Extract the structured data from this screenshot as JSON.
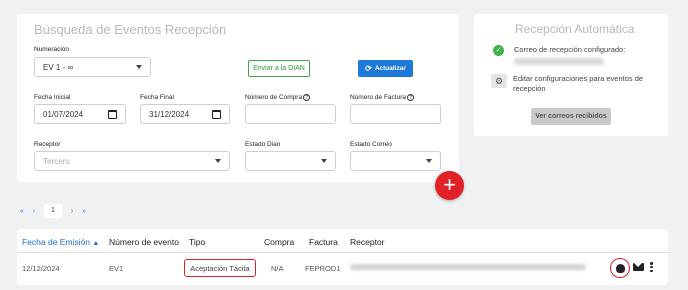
{
  "search": {
    "title": "Búsqueda de Eventos Recepción",
    "numeracion_label": "Numeración",
    "numeracion_value": "EV 1 - ∞",
    "enviar_dian_label": "Enviar a la DIAN",
    "actualizar_label": "Actualizar",
    "fecha_inicial_label": "Fecha Inicial",
    "fecha_inicial_value": "01/07/2024",
    "fecha_final_label": "Fecha Final",
    "fecha_final_value": "31/12/2024",
    "numero_compra_label": "Número de Compra",
    "numero_factura_label": "Número de Factura",
    "receptor_label": "Receptor",
    "receptor_placeholder": "Tercero",
    "estado_dian_label": "Estado Dian",
    "estado_correo_label": "Estado Correo"
  },
  "auto": {
    "title": "Recepción Automática",
    "correo_configurado": "Correo de recepción configurado:",
    "editar_config": "Editar configuraciones para eventos de recepción",
    "ver_correos": "Ver correos recibidos"
  },
  "pager": {
    "first": "«",
    "prev": "‹",
    "page": "1",
    "next": "›",
    "last": "»"
  },
  "table": {
    "headers": [
      "Fecha de Emisión",
      "Número de evento",
      "Tipo",
      "Compra",
      "Factura",
      "Receptor"
    ],
    "rows": [
      {
        "fecha": "12/12/2024",
        "evento": "EV1",
        "tipo": "Aceptación Tácita",
        "compra": "N/A",
        "factura": "FEPROD1"
      }
    ]
  },
  "colors": {
    "primary": "#1e7ad8",
    "success": "#3ea84a",
    "danger": "#e12126"
  }
}
